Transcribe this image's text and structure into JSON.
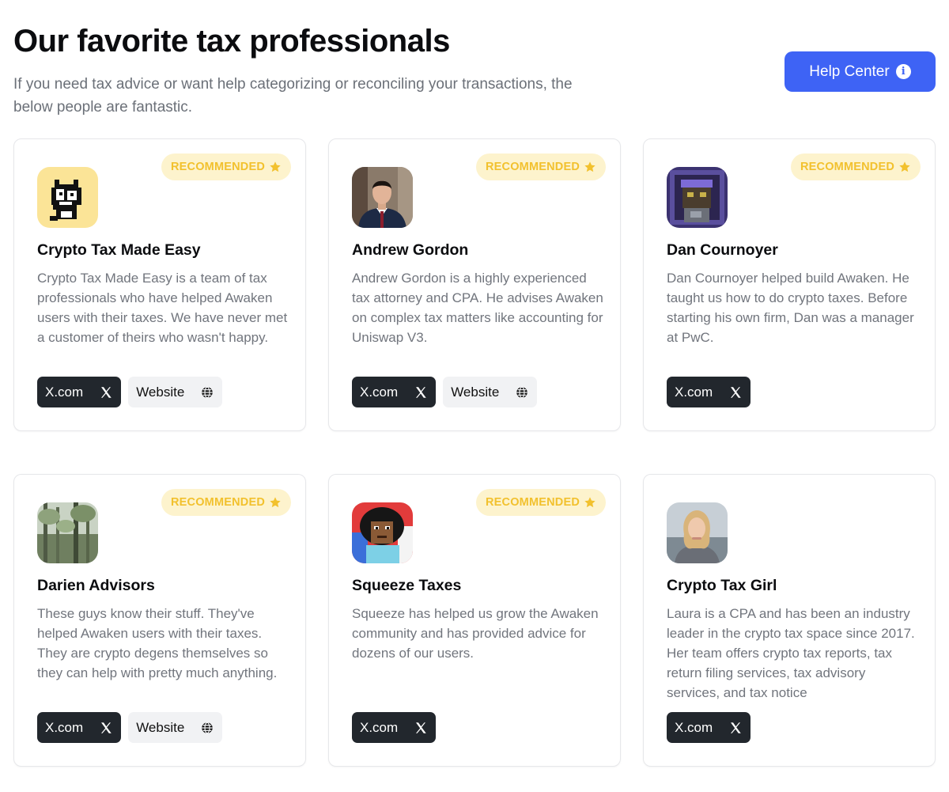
{
  "page": {
    "title": "Our favorite tax professionals",
    "subtitle": "If you need tax advice or want help categorizing or reconciling your transactions, the below people are fantastic.",
    "help_button": "Help Center",
    "help_icon": "info-icon"
  },
  "colors": {
    "accent": "#3e63f5",
    "badge_bg": "#fdf3cd",
    "badge_text": "#f2c12e",
    "dark_button": "#22272d"
  },
  "cards": [
    {
      "badge": "RECOMMENDED",
      "name": "Crypto Tax Made Easy",
      "description": "Crypto Tax Made Easy is a team of tax professionals who have helped Awaken users with their taxes. We have never met a customer of theirs who wasn't happy.",
      "x_label": "X.com",
      "website_label": "Website"
    },
    {
      "badge": "RECOMMENDED",
      "name": "Andrew Gordon",
      "description": "Andrew Gordon is a highly experienced tax attorney and CPA. He advises Awaken on complex tax matters like accounting for Uniswap V3.",
      "x_label": "X.com",
      "website_label": "Website"
    },
    {
      "badge": "RECOMMENDED",
      "name": "Dan Cournoyer",
      "description": "Dan Cournoyer helped build Awaken. He taught us how to do crypto taxes. Before starting his own firm, Dan was a manager at PwC.",
      "x_label": "X.com"
    },
    {
      "badge": "RECOMMENDED",
      "name": "Darien Advisors",
      "description": "These guys know their stuff. They've helped Awaken users with their taxes. They are crypto degens themselves so they can help with pretty much anything.",
      "x_label": "X.com",
      "website_label": "Website"
    },
    {
      "badge": "RECOMMENDED",
      "name": "Squeeze Taxes",
      "description": "Squeeze has helped us grow the Awaken community and has provided advice for dozens of our users.",
      "x_label": "X.com"
    },
    {
      "name": "Crypto Tax Girl",
      "description": "Laura is a CPA and has been an industry leader in the crypto tax space since 2017. Her team offers crypto tax reports, tax return filing services, tax advisory services, and tax notice",
      "x_label": "X.com"
    }
  ]
}
